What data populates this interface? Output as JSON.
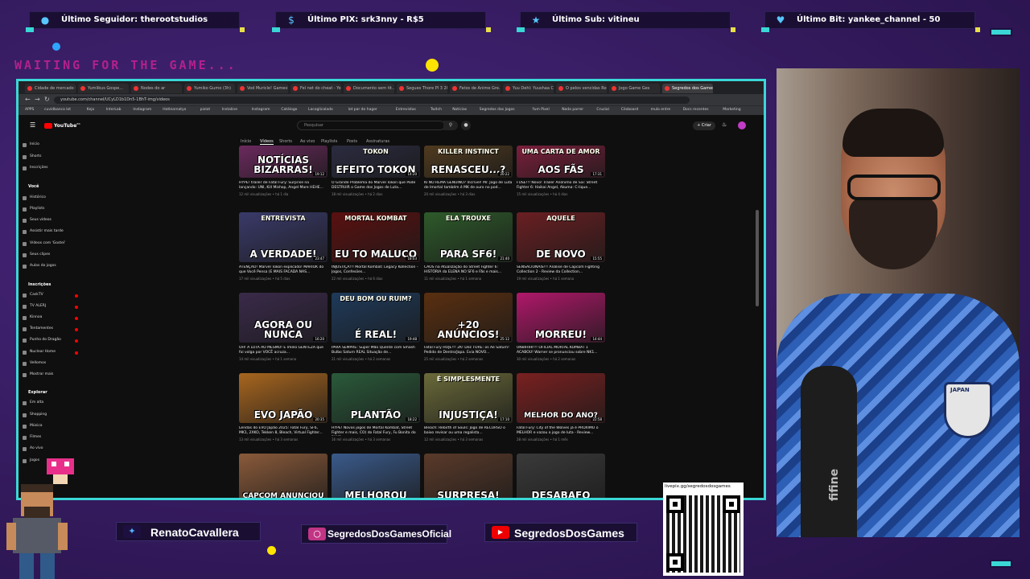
{
  "alerts": [
    {
      "icon": "user-icon",
      "text": "Último Seguidor: therootstudios"
    },
    {
      "icon": "pix-icon",
      "text": "Último PIX: srk3nny - R$5"
    },
    {
      "icon": "star-icon",
      "text": "Último Sub: vitineu"
    },
    {
      "icon": "heart-icon",
      "text": "Último Bit: yankee_channel - 50"
    }
  ],
  "waiting_text": "WAITING FOR THE GAME...",
  "browser": {
    "tabs": [
      "Cidade de mercado Sh...",
      "Yumlikus Gospe...",
      "Nodes do ar",
      "Yumiko Gumo (3h)",
      "Vod Muricle! Games! Ge...",
      "Fel net do cheat - YouTube",
      "Documento sem tit...",
      "Segues Thore Pl 3 2024",
      "Fatos de Anime Gre...",
      "Yuu Dehl: Yuushaa Cro...",
      "O pelos vencidas Roll...",
      "Jogo Game Ges",
      "Segredos dos Games"
    ],
    "url": "youtube.com/channel/UCyLD1b1Dn5-1BhT-img/videos",
    "bookmarks": [
      "APPS",
      "cuvidbanca lot",
      "Kejo",
      "InterLab",
      "Instagram",
      "Hotlearnatyo",
      "pixlot",
      "Instaline",
      "Instagram",
      "Catálogo",
      "Lacoglicalado",
      "lot par do hager",
      "Entrevistas",
      "Twitch",
      "Notícias",
      "Segredos das Jogos",
      "Yum Pixel",
      "Nada parrer",
      "Cruzial",
      "Ciloboard",
      "mulo entre",
      "Docs recentes",
      "Marketing"
    ]
  },
  "youtube": {
    "logo": "YouTube",
    "logo_sup": "BR",
    "search_placeholder": "Pesquisar",
    "create_label": "+ Criar",
    "channel_tabs": [
      "Início",
      "Vídeos",
      "Shorts",
      "Ao vivo",
      "Playlists",
      "Posts",
      "Assinaturas"
    ],
    "sidebar_top": [
      "Início",
      "Shorts",
      "Inscrições"
    ],
    "you_header": "Você",
    "you_items": [
      "Histórico",
      "Playlists",
      "Seus vídeos",
      "Assistir mais tarde",
      "Vídeos com 'Gostei'",
      "Seus clipes",
      "Aulas do jogos"
    ],
    "subs_header": "Inscrições",
    "subs_items": [
      "CaskTV",
      "TV ALERJ",
      "Kinnoa",
      "Tentamentes",
      "Punho do Dragão",
      "Nuclear Home",
      "Vellomos",
      "Mostrar mais"
    ],
    "explore_header": "Explorar",
    "explore_items": [
      "Em alta",
      "Shopping",
      "Música",
      "Filmes",
      "Ao vivo",
      "Jogos"
    ],
    "videos": [
      {
        "cap": "NOTÍCIAS BIZARRAS!",
        "cap2": "",
        "bg": "#6b2a5e",
        "title": "HYPE! trailer de Fatal Fury: Surprise na lançando: UNI, Kill Mishop, Angel Mare HEHE...",
        "meta": "12 mil visualizações • há 1 dia",
        "dur": "19:12"
      },
      {
        "cap": "EFEITO TOKON",
        "cap2": "TOKON",
        "bg": "#2b2b40",
        "title": "O Grande Problema do Marvel Tokon que Pode DESTRUIR o Game dos Jogos de Luta...",
        "meta": "18 mil visualizações • há 2 dias",
        "dur": "14:20"
      },
      {
        "cap": "RENASCEU...?",
        "cap2": "KILLER INSTINCT",
        "bg": "#4f3a1f",
        "title": "KI NO REMA GENUINO? Incrível! Mr. Jogo de Luta de Imortal também é MK de ouro no pod...",
        "meta": "20 mil visualizações • há 3 dias",
        "dur": "20:22"
      },
      {
        "cap": "AOS FÃS",
        "cap2": "UMA CARTA DE AMOR",
        "bg": "#7a1f3b",
        "title": "FUSE!!! Novo! Trailer Anônimo de Six: Street Fighter 6: Haikai Angel, Akuma: C-lique...",
        "meta": "15 mil visualizações • há 4 dias",
        "dur": "17:31"
      },
      {
        "cap": "A VERDADE!",
        "cap2": "ENTREVISTA",
        "bg": "#3a3a6a",
        "title": "ATENÇÃO! Marvel Tokon explicado! MARIOK do que Você Pensa (E MAIS FACADA NAS...",
        "meta": "17 mil visualizações • há 5 dias",
        "dur": "23:47"
      },
      {
        "cap": "EU TO MALUCO",
        "cap2": "MORTAL KOMBAT",
        "bg": "#5a1010",
        "title": "INJUSTIÇA!!! Mortal Kombat: Legacy Kollection - Jogos, Confesões...",
        "meta": "22 mil visualizações • há 6 dias",
        "dur": "18:03"
      },
      {
        "cap": "PARA SF6!",
        "cap2": "ELA TROUXE",
        "bg": "#2e5a2a",
        "title": "CAOS na Atualização do Street Fighter 6: HISTÓRIA da ELENA NO SF6 e Fãs e mais...",
        "meta": "11 mil visualizações • há 1 semana",
        "dur": "21:40"
      },
      {
        "cap": "DE NOVO",
        "cap2": "AQUELE",
        "bg": "#6a1f22",
        "title": "SENSACIONAIS!!! Análise de Capcom Fighting Collection 2 - Review da Collection...",
        "meta": "19 mil visualizações • há 1 semana",
        "dur": "15:55"
      },
      {
        "cap": "AGORA OU NUNCA",
        "cap2": "",
        "bg": "#3a2a4a",
        "title": "OH! A LUTA AO MESMO! E Imelo GENTEZA que foi volga por VOCÊ acruza...",
        "meta": "14 mil visualizações • há 1 semana",
        "dur": "16:20"
      },
      {
        "cap": "É REAL!",
        "cap2": "DEU BOM OU RUIM?",
        "bg": "#1f3a5a",
        "title": "PARA SEMPRE: Super Mão Quente com Smash Bulbo Saturn REAL Situação de...",
        "meta": "21 mil visualizações • há 2 semanas",
        "dur": "19:48"
      },
      {
        "cap": "+20 ANÚNCIOS!",
        "cap2": "",
        "bg": "#5a2f10",
        "title": "Fatal Fury HOJE!!! 2K! Dez TORE: os Ae Saturn! Pedido de Dentro/Japa. Evia NOVO...",
        "meta": "25 mil visualizações • há 2 semanas",
        "dur": "25:12"
      },
      {
        "cap": "MORREU!",
        "cap2": "",
        "bg": "#b0186a",
        "title": "UNBIHIHI!!! OFICIAL MORTAL KOMBAT 1 ACABOU! Warner se pronunciou sobre NK1...",
        "meta": "30 mil visualizações • há 2 semanas",
        "dur": "14:44"
      },
      {
        "cap": "EVO JAPÃO",
        "cap2": "",
        "bg": "#a8661f",
        "title": "Lendas do EVO Japão 2025: Fatal Fury, SF6, MK1, 2XKO, Tekken 8, Bleach, Virtual Fighter...",
        "meta": "13 mil visualizações • há 3 semanas",
        "dur": "20:35"
      },
      {
        "cap": "PLANTÃO",
        "cap2": "",
        "bg": "#2a5a3a",
        "title": "HYPE! Novos jogos de Mortal Kombat, Street Fighter e mais, CO) do Fatal Fury, Fu Bonita do 2XKO...",
        "meta": "16 mil visualizações • há 3 semanas",
        "dur": "18:22"
      },
      {
        "cap": "INJUSTIÇA!",
        "cap2": "É SIMPLESMENTE",
        "bg": "#6a6a3a",
        "title": "Bleach: Rebirth of Souls: Jogo de RECURSO o baixo revisar ou uma regalista...",
        "meta": "12 mil visualizações • há 3 semanas",
        "dur": "17:10"
      },
      {
        "cap": "MELHOR DO ANO?",
        "cap2": "",
        "bg": "#7a2020",
        "title": "Fatal Fury: City of the Wolves já é PRÓXIMO o MELHOR e vazou o jogo de luta - Review...",
        "meta": "28 mil visualizações • há 1 mês",
        "dur": "22:58"
      },
      {
        "cap": "CAPCOM ANUNCIOU",
        "cap2": "",
        "bg": "#8a5a3a",
        "title": "",
        "meta": "",
        "dur": ""
      },
      {
        "cap": "MELHOROU",
        "cap2": "",
        "bg": "#3a5a8a",
        "title": "",
        "meta": "",
        "dur": ""
      },
      {
        "cap": "SURPRESA!",
        "cap2": "",
        "bg": "#5a3a2a",
        "title": "",
        "meta": "",
        "dur": ""
      },
      {
        "cap": "DESABAFO",
        "cap2": "",
        "bg": "#3a3a3a",
        "title": "",
        "meta": "",
        "dur": ""
      }
    ]
  },
  "webcam": {
    "mic_brand": "fifine",
    "badge_text": "JAPAN"
  },
  "social": [
    {
      "icon": "twitter-icon",
      "text": "RenatoCavallera"
    },
    {
      "icon": "instagram-icon",
      "text": "SegredosDosGamesOficial"
    },
    {
      "icon": "youtube-icon",
      "text": "SegredosDosGames"
    }
  ],
  "qr": {
    "label": "livepix.gg/segredosdosgames"
  },
  "colors": {
    "accent": "#3ad7d6",
    "bg": "#3c1f66",
    "highlight": "#b3218c",
    "yellow": "#ffe400"
  }
}
